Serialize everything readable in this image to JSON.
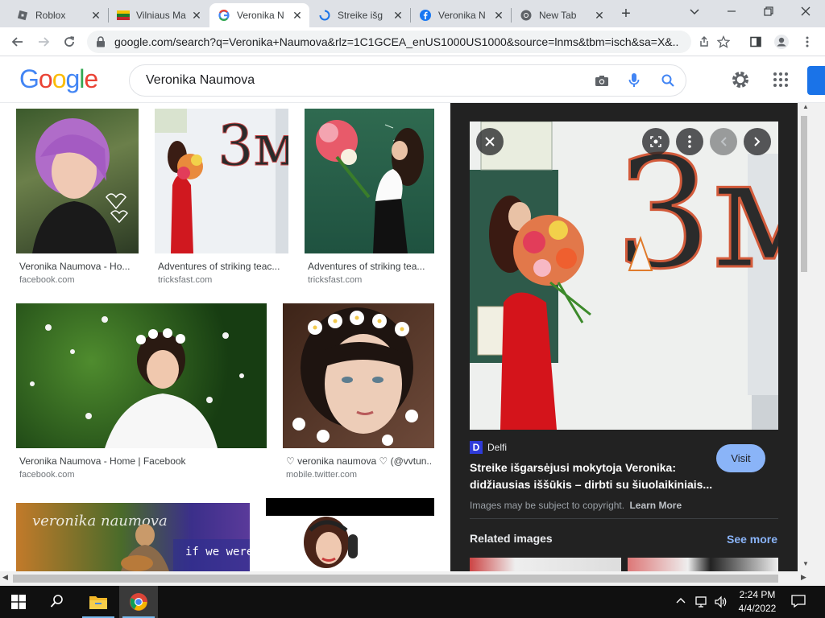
{
  "tabs": [
    {
      "title": "Roblox",
      "icon": "roblox-icon",
      "close": "✕"
    },
    {
      "title": "Vilniaus Ma",
      "icon": "crown-icon",
      "close": "✕"
    },
    {
      "title": "Veronika N",
      "icon": "google-icon",
      "close": "✕"
    },
    {
      "title": "Streike išg",
      "icon": "loading-icon",
      "close": "✕"
    },
    {
      "title": "Veronika N",
      "icon": "facebook-icon",
      "close": "✕"
    },
    {
      "title": "New Tab",
      "icon": "chrome-icon",
      "close": "✕"
    }
  ],
  "new_tab_glyph": "+",
  "address": {
    "url": "google.com/search?q=Veronika+Naumova&rlz=1C1GCEA_enUS1000US1000&source=lnms&tbm=isch&sa=X&..."
  },
  "google": {
    "logo_letters": [
      "G",
      "o",
      "o",
      "g",
      "l",
      "e"
    ],
    "query": "Veronika Naumova"
  },
  "results": [
    {
      "title": "Veronika Naumova - Ho...",
      "source": "facebook.com"
    },
    {
      "title": "Adventures of striking teac...",
      "source": "tricksfast.com"
    },
    {
      "title": "Adventures of striking tea...",
      "source": "tricksfast.com"
    },
    {
      "title": "Veronika Naumova - Home | Facebook",
      "source": "facebook.com"
    },
    {
      "title": "♡ veronika naumova ♡ (@vvtun...",
      "source": "mobile.twitter.com"
    }
  ],
  "thumb_text": {
    "bigm": "3м",
    "overlay_name": "veronika naumova",
    "overlay_song": "if we weren't afraid"
  },
  "preview": {
    "site_badge": "D",
    "site_name": "Delfi",
    "title_line1": "Streike išgarsėjusi mokytoja Veronika:",
    "title_line2": "didžiausias iššūkis – dirbti su šiuolaikiniais...",
    "visit_label": "Visit",
    "copyright": "Images may be subject to copyright.",
    "learn_more": "Learn More",
    "related_heading": "Related images",
    "see_more": "See more"
  },
  "taskbar": {
    "time": "2:24 PM",
    "date": "4/4/2022"
  },
  "colors": {
    "google_blue": "#4285f4",
    "google_red": "#ea4335",
    "google_yellow": "#fbbc05",
    "google_green": "#34a853",
    "visit_button": "#8ab4f8",
    "see_more": "#8ab4f8",
    "panel_bg": "#222222"
  }
}
